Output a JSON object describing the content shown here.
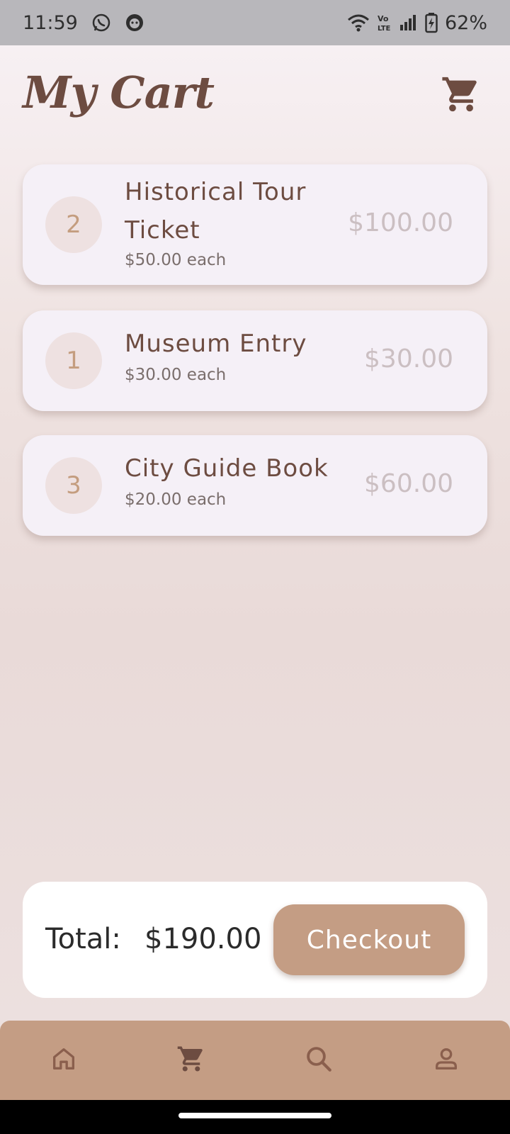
{
  "status_bar": {
    "time": "11:59",
    "battery": "62%",
    "icons": [
      "whatsapp-icon",
      "app-notification-icon",
      "wifi-icon",
      "volte-icon",
      "signal-icon",
      "battery-charging-icon"
    ]
  },
  "header": {
    "title": "My Cart",
    "icon": "cart-icon"
  },
  "cart": {
    "items": [
      {
        "quantity": "2",
        "name": "Historical Tour Ticket",
        "unit_price": "$50.00 each",
        "line_total": "$100.00"
      },
      {
        "quantity": "1",
        "name": "Museum Entry",
        "unit_price": "$30.00 each",
        "line_total": "$30.00"
      },
      {
        "quantity": "3",
        "name": "City Guide Book",
        "unit_price": "$20.00 each",
        "line_total": "$60.00"
      }
    ]
  },
  "summary": {
    "total_label": "Total:",
    "total_value": "$190.00",
    "checkout_label": "Checkout"
  },
  "bottom_nav": {
    "items": [
      {
        "icon": "home-icon",
        "active": false
      },
      {
        "icon": "cart-icon",
        "active": true
      },
      {
        "icon": "search-icon",
        "active": false
      },
      {
        "icon": "profile-icon",
        "active": false
      }
    ]
  },
  "colors": {
    "accent": "#c49d84",
    "brand_dark": "#6d4c41",
    "card": "#f5f0f7",
    "status_bar": "#b8b7bb"
  }
}
